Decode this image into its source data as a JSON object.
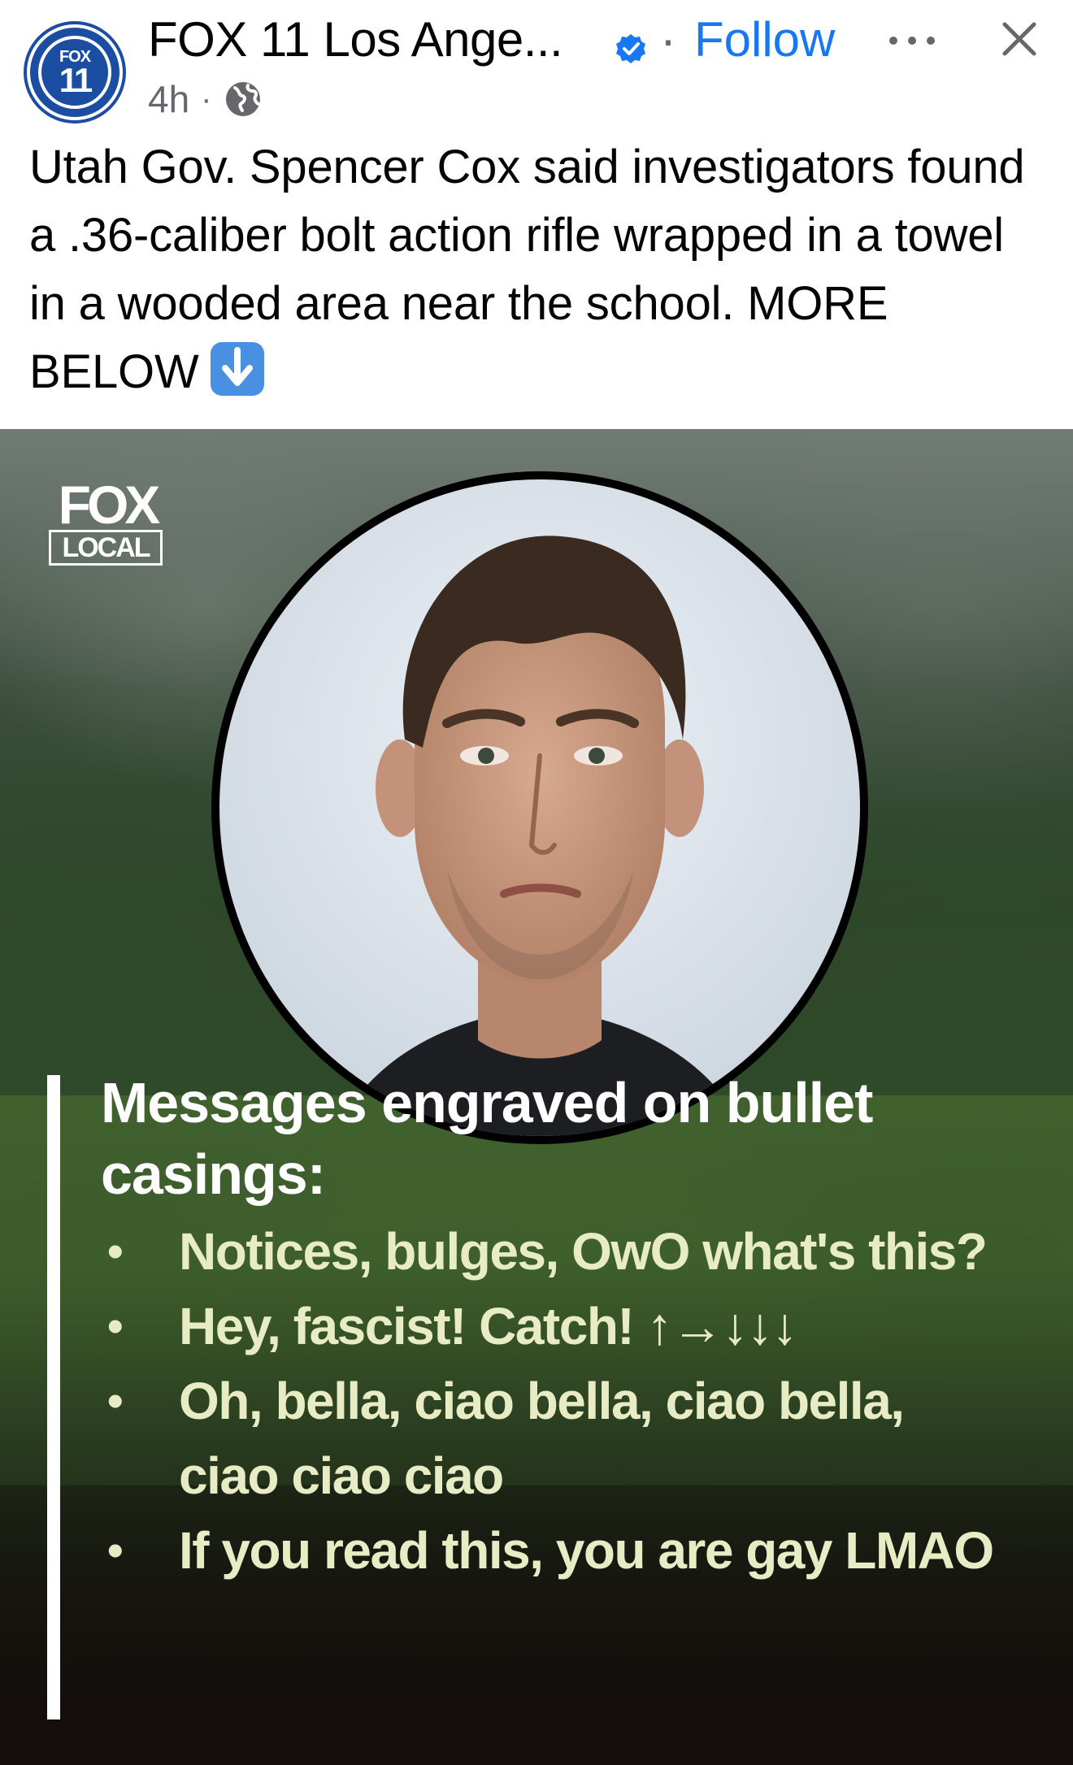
{
  "post": {
    "page_name": "FOX 11 Los Ange...",
    "avatar_top": "FOX",
    "avatar_number": "11",
    "separator": "·",
    "follow_label": "Follow",
    "time": "4h",
    "time_separator": "·",
    "audience_icon": "globe-icon",
    "verified_icon": "verified-badge-icon",
    "caption": "Utah Gov. Spencer Cox said investigators found a .36-caliber bolt action rifle wrapped in a towel in a wooded area near the school. MORE BELOW",
    "caption_emoji": "down-arrow-emoji"
  },
  "media": {
    "logo_top": "FOX",
    "logo_bottom": "LOCAL",
    "overlay_title": "Messages engraved on bullet casings:",
    "bullet_symbol": "•",
    "bullets": [
      "Notices, bulges, OwO what's this?",
      "Hey, fascist! Catch! ↑→↓↓↓",
      "Oh, bella, ciao bella, ciao bella, ciao ciao ciao",
      "If you read this, you are gay LMAO"
    ]
  },
  "colors": {
    "follow_blue": "#1877f2",
    "verified_blue": "#1877f2",
    "secondary_gray": "#65676b",
    "bullet_text": "#e7ecc4",
    "fox_blue": "#1b4ea3"
  }
}
